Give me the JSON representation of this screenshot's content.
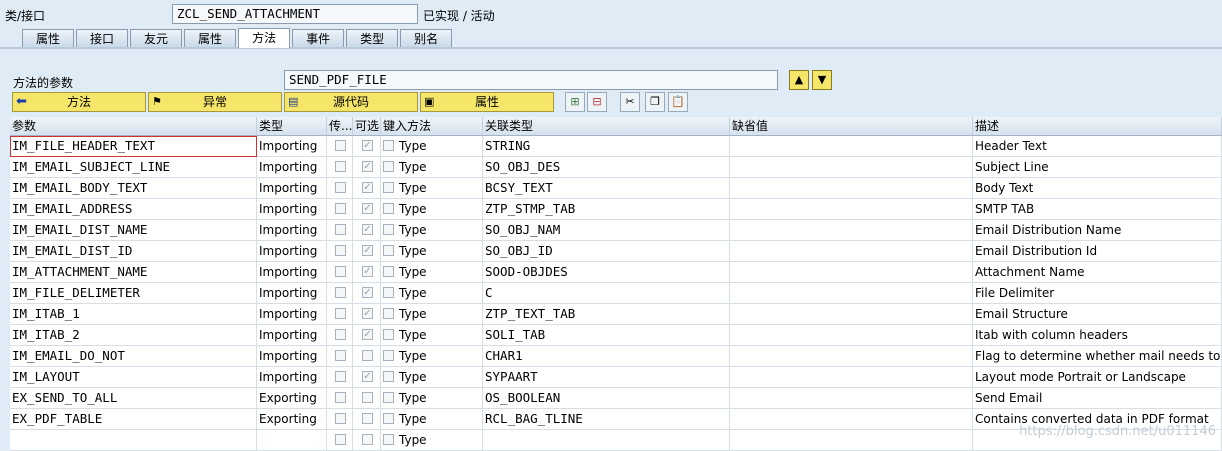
{
  "header": {
    "class_label": "类/接口",
    "class_value": "ZCL_SEND_ATTACHMENT",
    "status": "已实现 / 活动"
  },
  "tabs": [
    "属性",
    "接口",
    "友元",
    "属性",
    "方法",
    "事件",
    "类型",
    "别名"
  ],
  "active_tab": "方法",
  "method": {
    "label": "方法的参数",
    "value": "SEND_PDF_FILE"
  },
  "buttons": {
    "methods": "方法",
    "exceptions": "异常",
    "source_code": "源代码",
    "attributes": "属性"
  },
  "table": {
    "columns": [
      "参数",
      "类型",
      "传...",
      "可选",
      "键入方法",
      "关联类型",
      "缺省值",
      "描述"
    ],
    "rows": [
      {
        "param": "IM_FILE_HEADER_TEXT",
        "type": "Importing",
        "pass": false,
        "optional": true,
        "typing": "Type",
        "ref": "STRING",
        "default": "",
        "desc": "Header Text"
      },
      {
        "param": "IM_EMAIL_SUBJECT_LINE",
        "type": "Importing",
        "pass": false,
        "optional": true,
        "typing": "Type",
        "ref": "SO_OBJ_DES",
        "default": "",
        "desc": "Subject Line"
      },
      {
        "param": "IM_EMAIL_BODY_TEXT",
        "type": "Importing",
        "pass": false,
        "optional": true,
        "typing": "Type",
        "ref": "BCSY_TEXT",
        "default": "",
        "desc": "Body Text"
      },
      {
        "param": "IM_EMAIL_ADDRESS",
        "type": "Importing",
        "pass": false,
        "optional": true,
        "typing": "Type",
        "ref": "ZTP_STMP_TAB",
        "default": "",
        "desc": "SMTP TAB"
      },
      {
        "param": "IM_EMAIL_DIST_NAME",
        "type": "Importing",
        "pass": false,
        "optional": true,
        "typing": "Type",
        "ref": "SO_OBJ_NAM",
        "default": "",
        "desc": "Email Distribution Name"
      },
      {
        "param": "IM_EMAIL_DIST_ID",
        "type": "Importing",
        "pass": false,
        "optional": true,
        "typing": "Type",
        "ref": "SO_OBJ_ID",
        "default": "",
        "desc": "Email Distribution Id"
      },
      {
        "param": "IM_ATTACHMENT_NAME",
        "type": "Importing",
        "pass": false,
        "optional": true,
        "typing": "Type",
        "ref": "SOOD-OBJDES",
        "default": "",
        "desc": "Attachment Name"
      },
      {
        "param": "IM_FILE_DELIMETER",
        "type": "Importing",
        "pass": false,
        "optional": true,
        "typing": "Type",
        "ref": "C",
        "default": "",
        "desc": "File Delimiter"
      },
      {
        "param": "IM_ITAB_1",
        "type": "Importing",
        "pass": false,
        "optional": true,
        "typing": "Type",
        "ref": "ZTP_TEXT_TAB",
        "default": "",
        "desc": "Email Structure"
      },
      {
        "param": "IM_ITAB_2",
        "type": "Importing",
        "pass": false,
        "optional": true,
        "typing": "Type",
        "ref": "SOLI_TAB",
        "default": "",
        "desc": "Itab with column headers"
      },
      {
        "param": "IM_EMAIL_DO_NOT",
        "type": "Importing",
        "pass": false,
        "optional": false,
        "typing": "Type",
        "ref": "CHAR1",
        "default": "",
        "desc": "Flag to determine whether mail needs to b..."
      },
      {
        "param": "IM_LAYOUT",
        "type": "Importing",
        "pass": false,
        "optional": true,
        "typing": "Type",
        "ref": "SYPAART",
        "default": "",
        "desc": "Layout mode Portrait or Landscape"
      },
      {
        "param": "EX_SEND_TO_ALL",
        "type": "Exporting",
        "pass": false,
        "optional": false,
        "typing": "Type",
        "ref": "OS_BOOLEAN",
        "default": "",
        "desc": "Send Email"
      },
      {
        "param": "EX_PDF_TABLE",
        "type": "Exporting",
        "pass": false,
        "optional": false,
        "typing": "Type",
        "ref": "RCL_BAG_TLINE",
        "default": "",
        "desc": "Contains converted data in PDF format"
      },
      {
        "param": "",
        "type": "",
        "pass": false,
        "optional": false,
        "typing": "Type",
        "ref": "",
        "default": "",
        "desc": ""
      }
    ]
  },
  "watermark": "https://blog.csdn.net/u011146"
}
